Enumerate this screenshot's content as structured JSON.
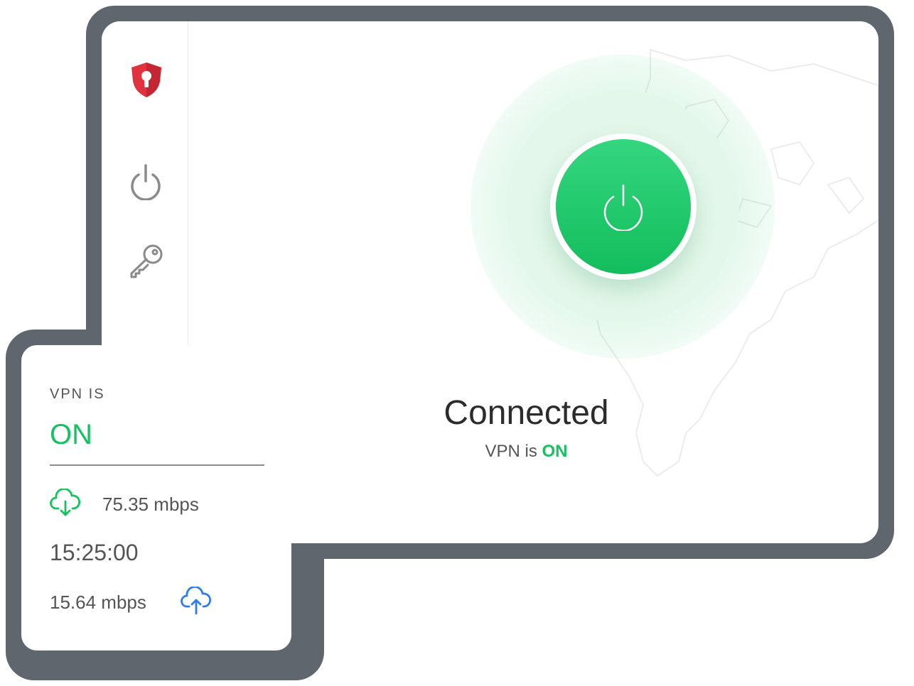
{
  "main": {
    "title": "Connected",
    "subtitle_prefix": "VPN is ",
    "subtitle_state": "ON"
  },
  "card": {
    "label": "VPN IS",
    "state": "ON",
    "download": "75.35 mbps",
    "duration": "15:25:00",
    "upload": "15.64 mbps"
  },
  "colors": {
    "connected_green": "#16c25f",
    "upload_blue": "#2f7ee8",
    "brand_red": "#e0333f",
    "backdrop": "#5f666e"
  },
  "icons": {
    "logo": "shield-keyhole-icon",
    "nav_power": "power-icon",
    "nav_key": "key-icon",
    "main_power": "power-icon",
    "download": "cloud-download-icon",
    "upload": "cloud-upload-icon"
  }
}
